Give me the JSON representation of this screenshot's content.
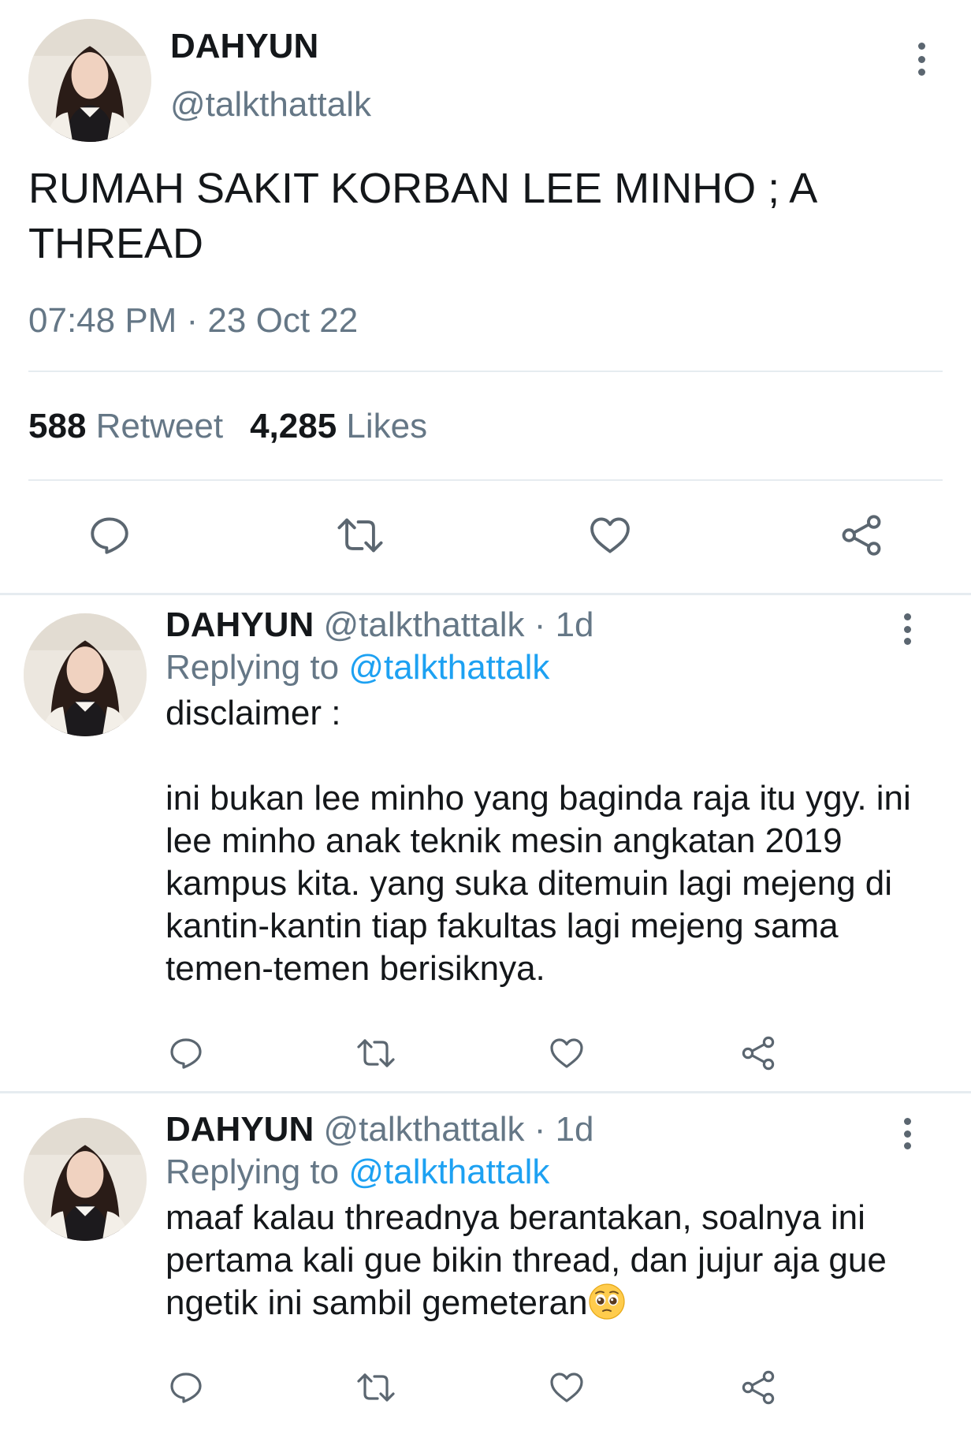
{
  "main_tweet": {
    "display_name": "DAHYUN",
    "handle": "@talkthattalk",
    "text": "RUMAH SAKIT KORBAN LEE MINHO ; A THREAD",
    "timestamp": "07:48 PM · 23 Oct 22",
    "retweet_count": "588",
    "retweet_label": "Retweet",
    "like_count": "4,285",
    "like_label": "Likes"
  },
  "replies": [
    {
      "display_name": "DAHYUN",
      "handle": "@talkthattalk",
      "age": "· 1d",
      "replying_prefix": "Replying to",
      "replying_handle": "@talkthattalk",
      "text": "disclaimer :\n\nini bukan lee minho yang baginda raja itu ygy. ini lee minho anak teknik mesin angkatan 2019 kampus kita. yang suka ditemuin lagi mejeng di kantin-kantin tiap fakultas lagi mejeng sama temen-temen berisiknya."
    },
    {
      "display_name": "DAHYUN",
      "handle": "@talkthattalk",
      "age": "· 1d",
      "replying_prefix": "Replying to",
      "replying_handle": "@talkthattalk",
      "text": "maaf kalau threadnya berantakan, soalnya ini pertama kali gue bikin thread, dan jujur aja gue ngetik ini sambil gemeteran",
      "trailing_emoji": "pleading-face-emoji"
    }
  ],
  "icons": {
    "reply": "reply-icon",
    "retweet": "retweet-icon",
    "like": "heart-icon",
    "share": "share-icon",
    "more": "more-vertical-icon"
  },
  "colors": {
    "text": "#14171a",
    "secondary": "#657786",
    "link": "#1da1f2",
    "divider": "#e6ecf0"
  }
}
